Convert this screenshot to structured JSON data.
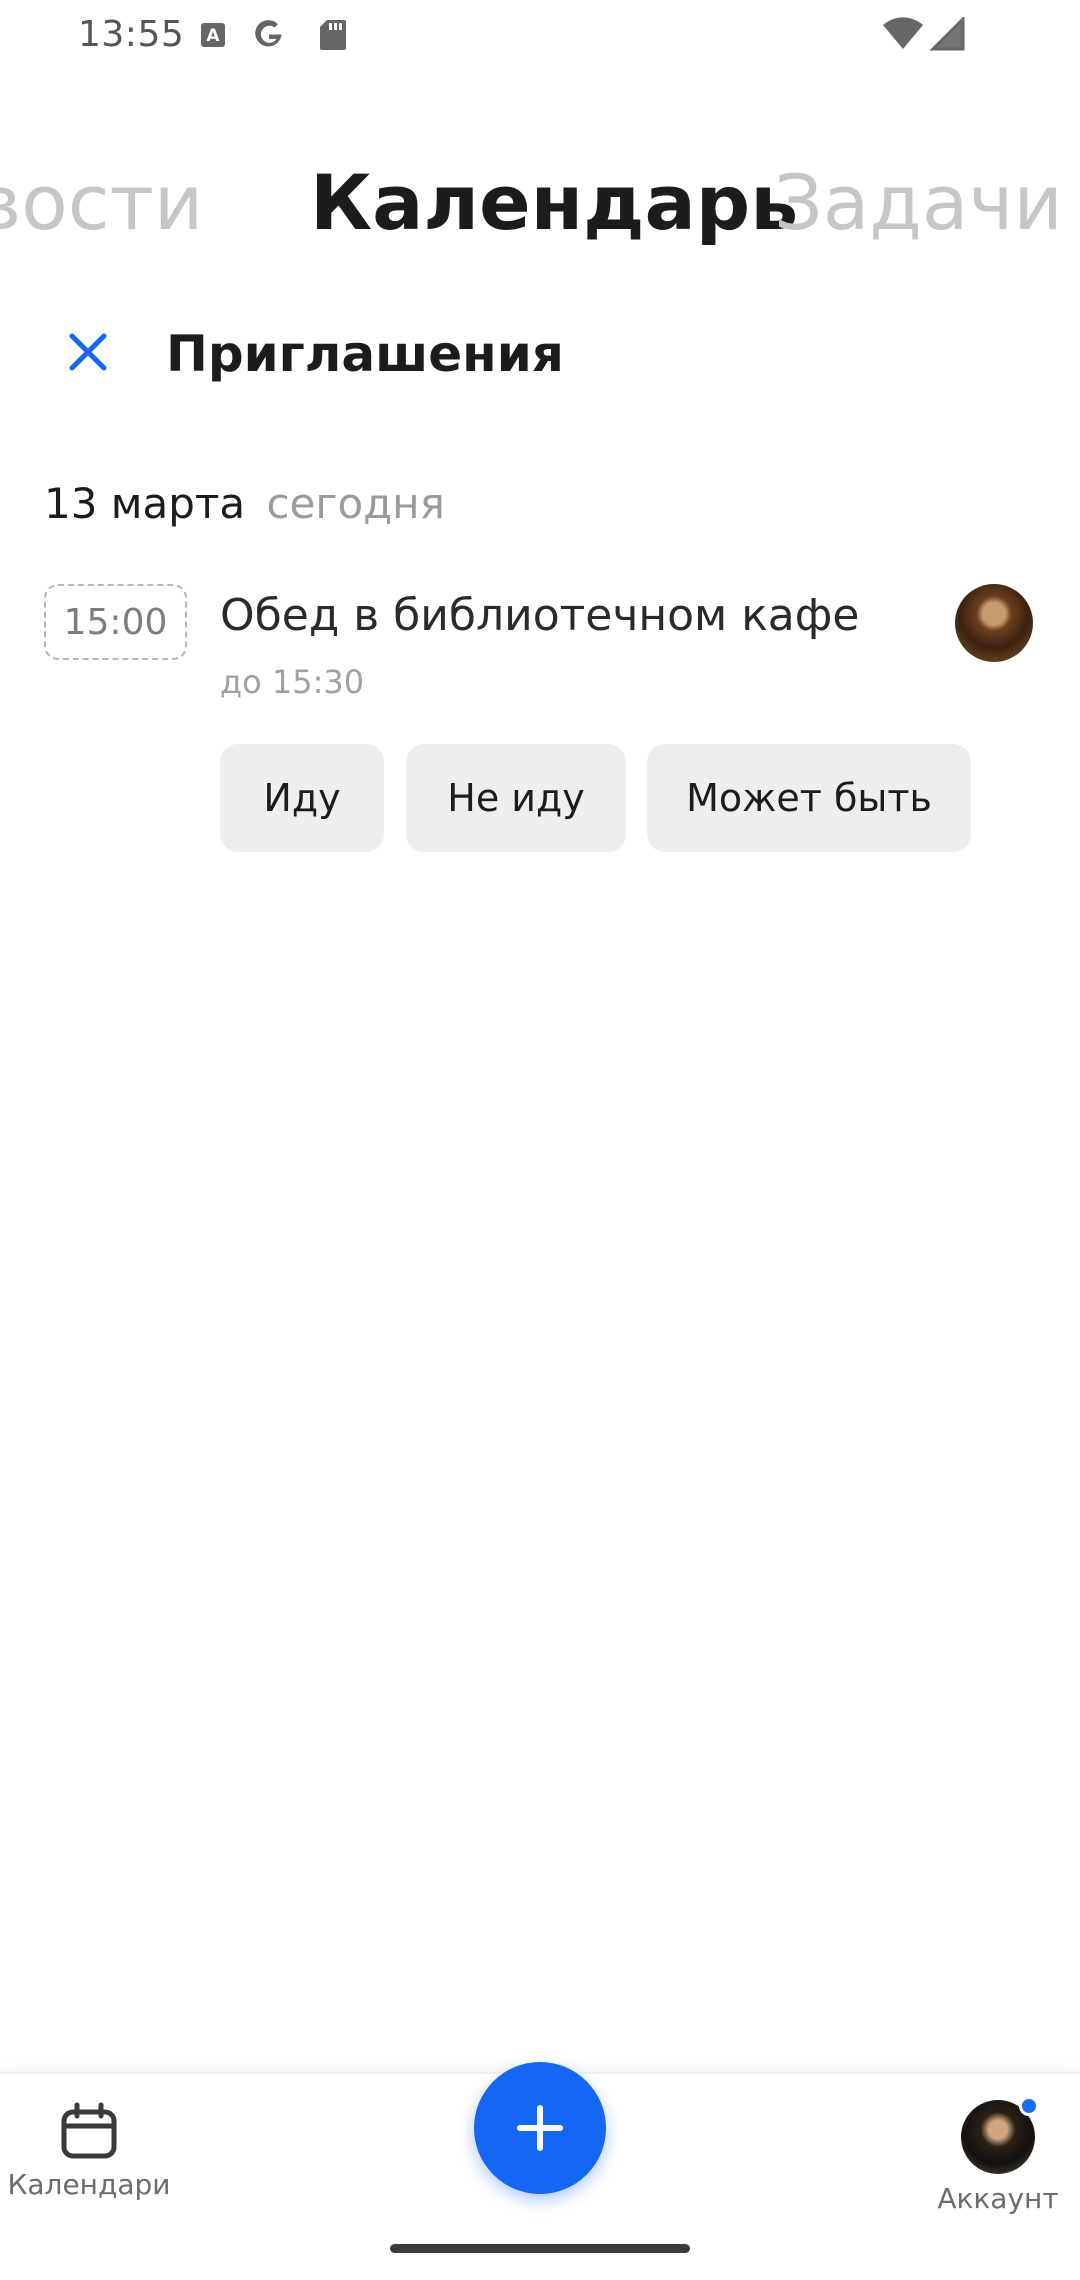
{
  "status_bar": {
    "time": "13:55",
    "icons": [
      "a-box-icon",
      "google-icon",
      "sd-card-icon",
      "wifi-icon",
      "signal-icon"
    ]
  },
  "section_tabs": [
    {
      "label": "овости",
      "active": false
    },
    {
      "label": "Календарь",
      "active": true
    },
    {
      "label": "Задачи",
      "active": false
    }
  ],
  "header": {
    "title": "Приглашения",
    "close_icon": "close-icon"
  },
  "date_group": {
    "day": "13 марта",
    "relative": "сегодня"
  },
  "event": {
    "time": "15:00",
    "title": "Обед в библиотечном кафе",
    "until": "до 15:30"
  },
  "rsvp": {
    "yes": "Иду",
    "no": "Не иду",
    "maybe": "Может быть"
  },
  "bottom_nav": {
    "calendars_label": "Календари",
    "account_label": "Аккаунт",
    "add_icon": "plus-icon"
  },
  "colors": {
    "accent": "#1466f5",
    "text": "#1c1c1e",
    "muted": "#9a9a9f",
    "button_bg": "#eeeef0"
  }
}
